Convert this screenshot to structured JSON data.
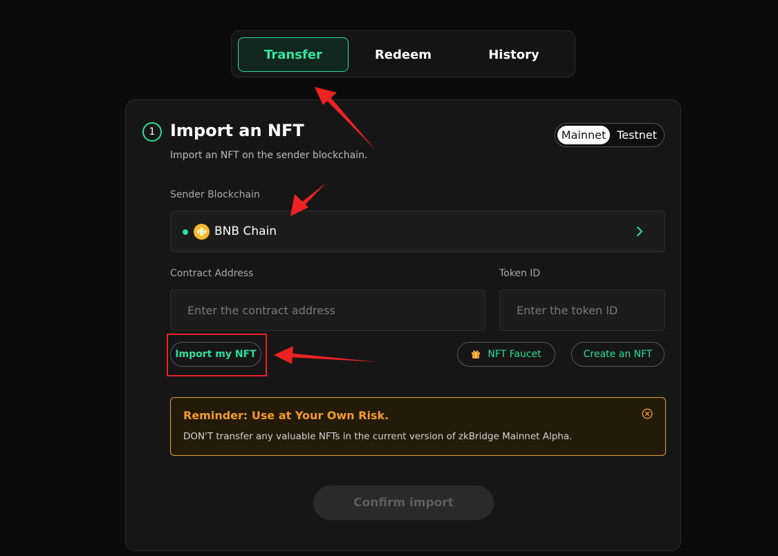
{
  "tabs": [
    {
      "label": "Transfer",
      "active": true
    },
    {
      "label": "Redeem",
      "active": false
    },
    {
      "label": "History",
      "active": false
    }
  ],
  "card": {
    "step_number": "1",
    "title": "Import an NFT",
    "subtitle": "Import an NFT on the sender blockchain.",
    "network_toggle": {
      "options": [
        "Mainnet",
        "Testnet"
      ],
      "selected": "Mainnet"
    },
    "sender_blockchain": {
      "label": "Sender Blockchain",
      "value": "BNB Chain",
      "icon": "bnb-chain-icon",
      "status_color": "#2bdf9c"
    },
    "contract_address": {
      "label": "Contract Address",
      "placeholder": "Enter the contract address",
      "value": ""
    },
    "token_id": {
      "label": "Token ID",
      "placeholder": "Enter the token ID",
      "value": ""
    },
    "buttons": {
      "import_my_nft": "Import my NFT",
      "nft_faucet": "NFT Faucet",
      "create_nft": "Create an NFT"
    },
    "reminder": {
      "title": "Reminder: Use at Your Own Risk.",
      "text": "DON'T transfer any valuable NFTs in the current version of zkBridge Mainnet Alpha."
    },
    "confirm_label": "Confirm import"
  },
  "colors": {
    "accent": "#2bdf9c",
    "warning": "#f29b2c",
    "annotation": "#ee2222",
    "background": "#0b0b0b"
  }
}
